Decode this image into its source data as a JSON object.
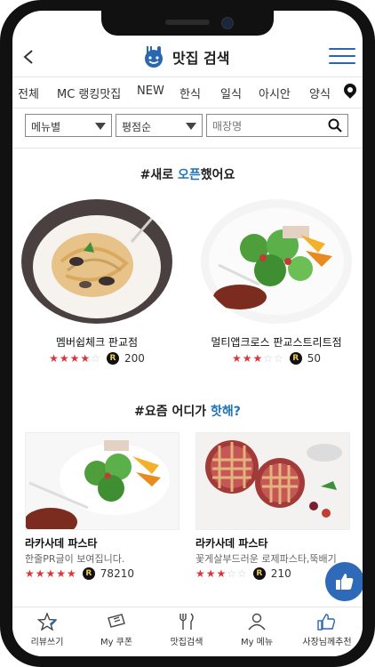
{
  "header": {
    "title": "맛집 검색"
  },
  "categories": [
    "전체",
    "MC 랭킹맛집",
    "NEW",
    "한식",
    "일식",
    "아시안",
    "양식"
  ],
  "filters": {
    "menu_select": "메뉴별",
    "sort_select": "평점순",
    "search_placeholder": "매장명"
  },
  "new_open": {
    "title_prefix": "#새로 ",
    "title_accent": "오픈",
    "title_suffix": "했어요",
    "items": [
      {
        "name": "멤버쉽체크 판교점",
        "stars": 4,
        "max_stars": 5,
        "reviews": "200"
      },
      {
        "name": "멀티앱크로스 판교스트리트점",
        "stars": 3,
        "max_stars": 5,
        "reviews": "50"
      }
    ]
  },
  "hot": {
    "title_prefix": "#요즘 어디가 ",
    "title_accent": "핫해?",
    "items": [
      {
        "name": "라카사데 파스타",
        "desc": "한줄PR글이 보여집니다.",
        "stars": 5,
        "max_stars": 5,
        "reviews": "78210"
      },
      {
        "name": "라카사데 파스타",
        "desc": "꽃게살부드러운 로제파스타,뚝배기",
        "stars": 3,
        "max_stars": 5,
        "reviews": "210"
      }
    ]
  },
  "bottom_nav": [
    {
      "label": "리뷰쓰기",
      "icon": "review-star-icon"
    },
    {
      "label": "My 쿠폰",
      "icon": "coupon-icon"
    },
    {
      "label": "맛집검색",
      "icon": "fork-knife-icon"
    },
    {
      "label": "My 메뉴",
      "icon": "user-icon"
    },
    {
      "label": "사장님께추천",
      "icon": "thumbs-up-icon"
    }
  ],
  "badge_letter": "R",
  "colors": {
    "accent": "#1f73b8",
    "star": "#d9363a",
    "floating_button": "#2f6ab8"
  }
}
